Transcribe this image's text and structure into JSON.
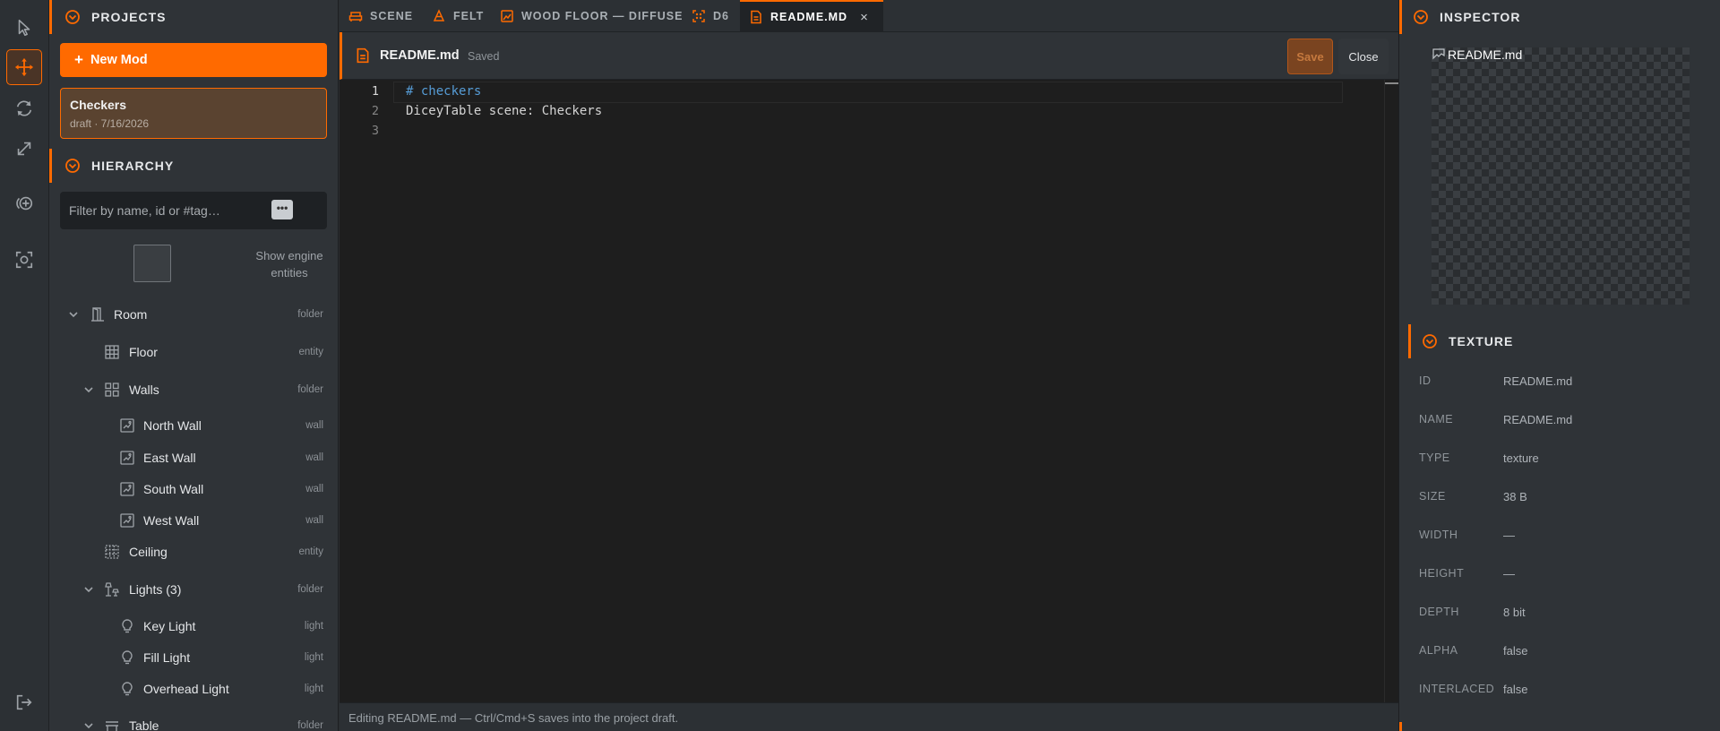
{
  "toolbar": {
    "tools": [
      {
        "name": "select-tool",
        "icon": "cursor-icon"
      },
      {
        "name": "move-tool",
        "icon": "move-arrows-icon",
        "active": true
      },
      {
        "name": "rotate-tool",
        "icon": "rotate-icon"
      },
      {
        "name": "scale-tool",
        "icon": "scale-diagonal-icon"
      },
      {
        "name": "add-entity-tool",
        "icon": "add-circle-icon"
      },
      {
        "name": "focus-tool",
        "icon": "focus-frame-icon"
      }
    ],
    "exit_icon": "logout-icon"
  },
  "projects": {
    "section_title": "PROJECTS",
    "new_mod_label": "New Mod",
    "card": {
      "name": "Checkers",
      "meta": "draft · 7/16/2026"
    }
  },
  "hierarchy": {
    "section_title": "HIERARCHY",
    "filter_placeholder": "Filter by name, id or #tag…",
    "filter_more_label": "•••",
    "show_engine_label": "Show engine entities",
    "items": [
      {
        "label": "Room",
        "type": "folder",
        "icon": "door-icon"
      },
      {
        "label": "Floor",
        "type": "entity",
        "icon": "grid-icon"
      },
      {
        "label": "Walls",
        "type": "folder",
        "icon": "four-squares-icon"
      },
      {
        "label": "North Wall",
        "type": "wall",
        "icon": "wall-icon"
      },
      {
        "label": "East Wall",
        "type": "wall",
        "icon": "wall-icon"
      },
      {
        "label": "South Wall",
        "type": "wall",
        "icon": "wall-icon"
      },
      {
        "label": "West Wall",
        "type": "wall",
        "icon": "wall-icon"
      },
      {
        "label": "Ceiling",
        "type": "entity",
        "icon": "dotted-grid-icon"
      },
      {
        "label": "Lights (3)",
        "type": "folder",
        "icon": "lamps-icon"
      },
      {
        "label": "Key Light",
        "type": "light",
        "icon": "bulb-icon"
      },
      {
        "label": "Fill Light",
        "type": "light",
        "icon": "bulb-icon"
      },
      {
        "label": "Overhead Light",
        "type": "light",
        "icon": "bulb-icon"
      },
      {
        "label": "Table",
        "type": "folder",
        "icon": "table-icon"
      }
    ]
  },
  "tabs": [
    {
      "label": "SCENE",
      "icon": "sofa-icon"
    },
    {
      "label": "FELT",
      "icon": "cone-icon"
    },
    {
      "label": "WOOD FLOOR — DIFFUSE",
      "icon": "image-icon"
    },
    {
      "label": "D6",
      "icon": "die-icon"
    },
    {
      "label": "README.MD",
      "icon": "document-icon",
      "active": true,
      "close": "×"
    }
  ],
  "editor": {
    "file_name": "README.md",
    "file_status": "Saved",
    "save_label": "Save",
    "close_label": "Close",
    "lines": [
      {
        "num": "1",
        "text": "# checkers"
      },
      {
        "num": "2",
        "text": "DiceyTable scene: Checkers"
      },
      {
        "num": "3",
        "text": ""
      }
    ],
    "status_text": "Editing README.md — Ctrl/Cmd+S saves into the project draft."
  },
  "inspector": {
    "section_title": "INSPECTOR",
    "preview_alt": "README.md",
    "texture_title": "TEXTURE",
    "props": [
      {
        "key": "ID",
        "value": "README.md"
      },
      {
        "key": "NAME",
        "value": "README.md"
      },
      {
        "key": "TYPE",
        "value": "texture"
      },
      {
        "key": "SIZE",
        "value": "38 B"
      },
      {
        "key": "WIDTH",
        "value": "—"
      },
      {
        "key": "HEIGHT",
        "value": "—"
      },
      {
        "key": "DEPTH",
        "value": "8 bit"
      },
      {
        "key": "ALPHA",
        "value": "false"
      },
      {
        "key": "INTERLACED",
        "value": "false"
      }
    ]
  },
  "colors": {
    "accent": "#ff6a00",
    "panel": "#2f3337",
    "editor_bg": "#1e1e1e",
    "heading_blue": "#569cd6"
  }
}
